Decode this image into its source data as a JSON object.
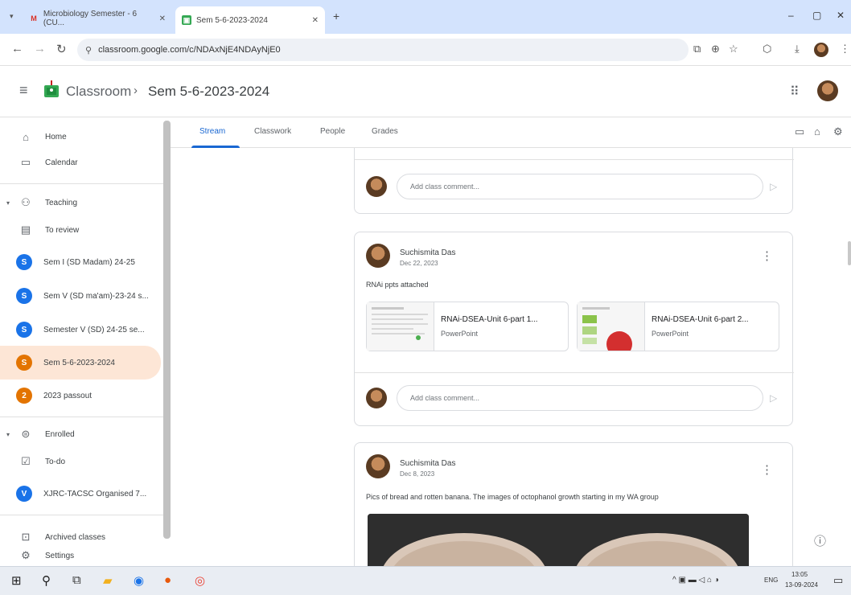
{
  "browser": {
    "tabs": [
      {
        "title": "Microbiology Semester - 6 (CU...",
        "favicon": "gmail-icon"
      },
      {
        "title": "Sem 5-6-2023-2024",
        "favicon": "classroom-icon"
      }
    ],
    "new_tab_label": "+",
    "url": "classroom.google.com/c/NDAxNjE4NDAyNjE0",
    "window_controls": {
      "minimize": "–",
      "maximize": "▢",
      "close": "✕"
    }
  },
  "app": {
    "name": "Classroom",
    "breadcrumb_sep": "›",
    "class_title": "Sem 5-6-2023-2024"
  },
  "sidebar": {
    "items": [
      {
        "label": "Home",
        "icon": "home-icon"
      },
      {
        "label": "Calendar",
        "icon": "calendar-icon"
      },
      {
        "label": "Teaching",
        "icon": "teaching-icon"
      },
      {
        "label": "To review",
        "icon": "to-review-icon"
      },
      {
        "label": "Sem I (SD Madam) 24-25",
        "avatar": "S",
        "color": "#1a73e8"
      },
      {
        "label": "Sem V (SD ma'am)-23-24 s...",
        "avatar": "S",
        "color": "#1a73e8"
      },
      {
        "label": "Semester V (SD) 24-25 se...",
        "avatar": "S",
        "color": "#1a73e8"
      },
      {
        "label": "Sem 5-6-2023-2024",
        "avatar": "S",
        "color": "#e37400"
      },
      {
        "label": "2023 passout",
        "avatar": "2",
        "color": "#e37400"
      },
      {
        "label": "Enrolled",
        "icon": "enrolled-icon"
      },
      {
        "label": "To-do",
        "icon": "todo-icon"
      },
      {
        "label": "XJRC-TACSC Organised 7...",
        "avatar": "V",
        "color": "#1a73e8"
      },
      {
        "label": "Archived classes",
        "icon": "archive-icon"
      },
      {
        "label": "Settings",
        "icon": "settings-icon"
      }
    ]
  },
  "class_tabs": [
    "Stream",
    "Classwork",
    "People",
    "Grades"
  ],
  "stream": {
    "comment_placeholder": "Add class comment...",
    "posts": [
      {
        "author": "Suchismita Das",
        "date": "Dec 22, 2023",
        "text": "RNAi ppts attached",
        "attachments": [
          {
            "title": "RNAi-DSEA-Unit 6-part 1...",
            "type": "PowerPoint"
          },
          {
            "title": "RNAi-DSEA-Unit 6-part 2...",
            "type": "PowerPoint"
          }
        ]
      },
      {
        "author": "Suchismita Das",
        "date": "Dec 8, 2023",
        "text": "Pics of bread and rotten banana. The images of octophanol growth starting in my WA group"
      }
    ]
  },
  "taskbar": {
    "lang": "ENG",
    "time": "13:05",
    "date": "13-09-2024"
  }
}
